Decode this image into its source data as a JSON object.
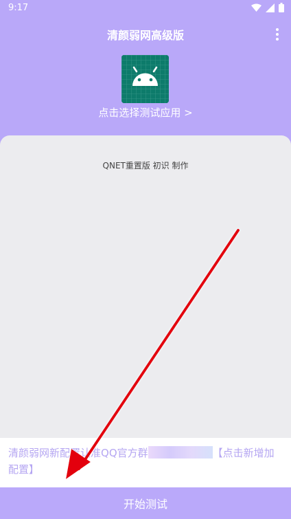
{
  "status_bar": {
    "time": "9:17"
  },
  "app_bar": {
    "title": "清颜弱网高级版"
  },
  "header": {
    "select_app_label": "点击选择测试应用 >"
  },
  "card": {
    "credit": "QNET重置版 初识 制作"
  },
  "notice": {
    "text_before": "清颜弱网新",
    "text_middle": "配置认准QQ官方群",
    "text_after": "【点击新增加配置】"
  },
  "bottom": {
    "start_label": "开始测试"
  },
  "colors": {
    "primary": "#b9a8f9",
    "card_bg": "#ececef",
    "notice_text": "#b5a6f2",
    "app_icon_bg": "#0d7b6b",
    "arrow": "#e3000f"
  },
  "icons": [
    "wifi-icon",
    "signal-icon",
    "battery-icon",
    "more-vert-icon",
    "android-icon"
  ]
}
